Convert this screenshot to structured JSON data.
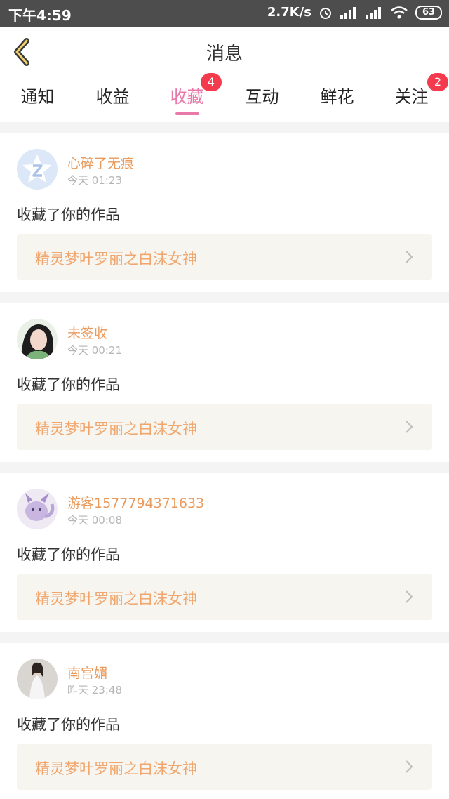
{
  "status_bar": {
    "time": "下午4:59",
    "speed": "2.7K/s",
    "battery": "63"
  },
  "header": {
    "title": "消息"
  },
  "tabs": [
    {
      "label": "通知",
      "badge": null,
      "active": false
    },
    {
      "label": "收益",
      "badge": null,
      "active": false
    },
    {
      "label": "收藏",
      "badge": "4",
      "active": true
    },
    {
      "label": "互动",
      "badge": null,
      "active": false
    },
    {
      "label": "鲜花",
      "badge": null,
      "active": false
    },
    {
      "label": "关注",
      "badge": "2",
      "active": false
    }
  ],
  "messages": [
    {
      "user": "心碎了无痕",
      "time": "今天 01:23",
      "action": "收藏了你的作品",
      "work_title": "精灵梦叶罗丽之白沫女神"
    },
    {
      "user": "未签收",
      "time": "今天 00:21",
      "action": "收藏了你的作品",
      "work_title": "精灵梦叶罗丽之白沫女神"
    },
    {
      "user": "游客1577794371633",
      "time": "今天 00:08",
      "action": "收藏了你的作品",
      "work_title": "精灵梦叶罗丽之白沫女神"
    },
    {
      "user": "南宫媚",
      "time": "昨天 23:48",
      "action": "收藏了你的作品",
      "work_title": "精灵梦叶罗丽之白沫女神"
    }
  ],
  "colors": {
    "accent_pink": "#e879a8",
    "username_orange": "#e99a5c",
    "work_title_orange": "#f0a66d",
    "badge_red": "#f43b4e"
  }
}
